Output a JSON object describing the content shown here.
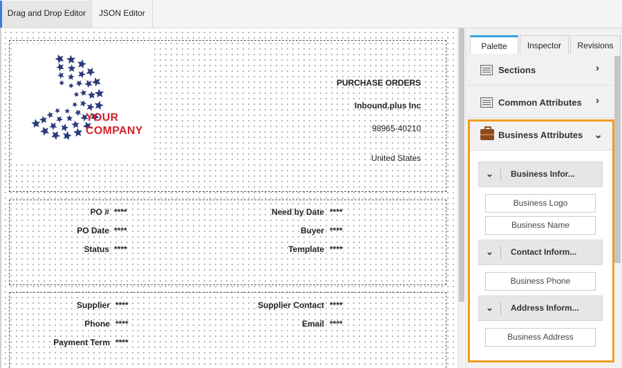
{
  "top_tabs": {
    "drag_drop": "Drag and Drop Editor",
    "json_editor": "JSON Editor"
  },
  "document": {
    "header": {
      "title": "PURCHASE ORDERS",
      "company": "Inbound.plus Inc",
      "phone": "98965-40210",
      "country": "United States"
    },
    "logo": {
      "line1": "YOUR",
      "line2": "COMPANY"
    },
    "order_fields": {
      "po_number": {
        "label": "PO #",
        "value": "****"
      },
      "po_date": {
        "label": "PO Date",
        "value": "****"
      },
      "status": {
        "label": "Status",
        "value": "****"
      },
      "need_by_date": {
        "label": "Need by Date",
        "value": "****"
      },
      "buyer": {
        "label": "Buyer",
        "value": "****"
      },
      "template": {
        "label": "Template",
        "value": "****"
      }
    },
    "supplier_fields": {
      "supplier": {
        "label": "Supplier",
        "value": "****"
      },
      "phone": {
        "label": "Phone",
        "value": "****"
      },
      "payment_term": {
        "label": "Payment Term",
        "value": "****"
      },
      "supplier_contact": {
        "label": "Supplier Contact",
        "value": "****"
      },
      "email": {
        "label": "Email",
        "value": "****"
      }
    }
  },
  "panel": {
    "tabs": {
      "palette": "Palette",
      "inspector": "Inspector",
      "revisions": "Revisions"
    },
    "sections": "Sections",
    "common_attributes": "Common Attributes",
    "business_attributes": {
      "title": "Business Attributes",
      "groups": {
        "business_info": {
          "title": "Business Infor...",
          "items": [
            "Business Logo",
            "Business Name"
          ]
        },
        "contact_info": {
          "title": "Contact Inform...",
          "items": [
            "Business Phone"
          ]
        },
        "address_info": {
          "title": "Address Inform...",
          "items": [
            "Business Address"
          ]
        }
      }
    }
  },
  "colors": {
    "highlight": "#f39b1f",
    "active_tab": "#2fa3dc",
    "logo_text": "#d2232a",
    "logo_stars": "#2b3a7a"
  }
}
